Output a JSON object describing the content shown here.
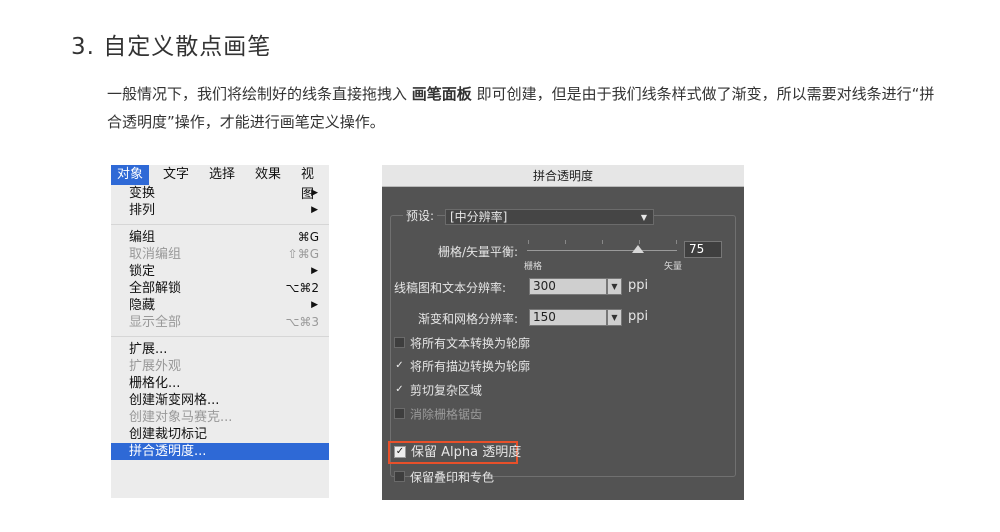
{
  "heading": "3. 自定义散点画笔",
  "paragraph": {
    "part1": "一般情况下，我们将绘制好的线条直接拖拽入 ",
    "bold": "画笔面板",
    "part2": " 即可创建，但是由于我们线条样式做了渐变，所以需要对线条进行“拼合透明度”操作，才能进行画笔定义操作。"
  },
  "menu": {
    "bar": [
      "对象",
      "文字",
      "选择",
      "效果",
      "视图"
    ],
    "items": [
      {
        "label": "变换",
        "shortcut": "▶",
        "disabled": false
      },
      {
        "label": "排列",
        "shortcut": "▶",
        "disabled": false
      },
      {
        "label": "编组",
        "shortcut": "⌘G",
        "disabled": false
      },
      {
        "label": "取消编组",
        "shortcut": "⇧⌘G",
        "disabled": true
      },
      {
        "label": "锁定",
        "shortcut": "▶",
        "disabled": false
      },
      {
        "label": "全部解锁",
        "shortcut": "⌥⌘2",
        "disabled": false
      },
      {
        "label": "隐藏",
        "shortcut": "▶",
        "disabled": false
      },
      {
        "label": "显示全部",
        "shortcut": "⌥⌘3",
        "disabled": true
      },
      {
        "label": "扩展...",
        "shortcut": "",
        "disabled": false
      },
      {
        "label": "扩展外观",
        "shortcut": "",
        "disabled": true
      },
      {
        "label": "栅格化...",
        "shortcut": "",
        "disabled": false
      },
      {
        "label": "创建渐变网格...",
        "shortcut": "",
        "disabled": false
      },
      {
        "label": "创建对象马赛克...",
        "shortcut": "",
        "disabled": true
      },
      {
        "label": "创建裁切标记",
        "shortcut": "",
        "disabled": false
      },
      {
        "label": "拼合透明度...",
        "shortcut": "",
        "disabled": false
      }
    ]
  },
  "dialog": {
    "title": "拼合透明度",
    "preset_label": "预设:",
    "preset_value": "[中分辨率]",
    "balance_label": "栅格/矢量平衡:",
    "balance_value": "75",
    "balance_left": "栅格",
    "balance_right": "矢量",
    "line_res_label": "线稿图和文本分辨率:",
    "line_res_value": "300",
    "grad_res_label": "渐变和网格分辨率:",
    "grad_res_value": "150",
    "unit": "ppi",
    "checkboxes": [
      {
        "label": "将所有文本转换为轮廓",
        "checked": false,
        "disabled": false
      },
      {
        "label": "将所有描边转换为轮廓",
        "checked": true,
        "disabled": false
      },
      {
        "label": "剪切复杂区域",
        "checked": true,
        "disabled": false
      },
      {
        "label": "消除栅格锯齿",
        "checked": false,
        "disabled": true
      }
    ],
    "alpha_label": "保留 Alpha 透明度",
    "alpha_checked": true,
    "overprint_label": "保留叠印和专色",
    "highlight_color": "#e8502a"
  }
}
